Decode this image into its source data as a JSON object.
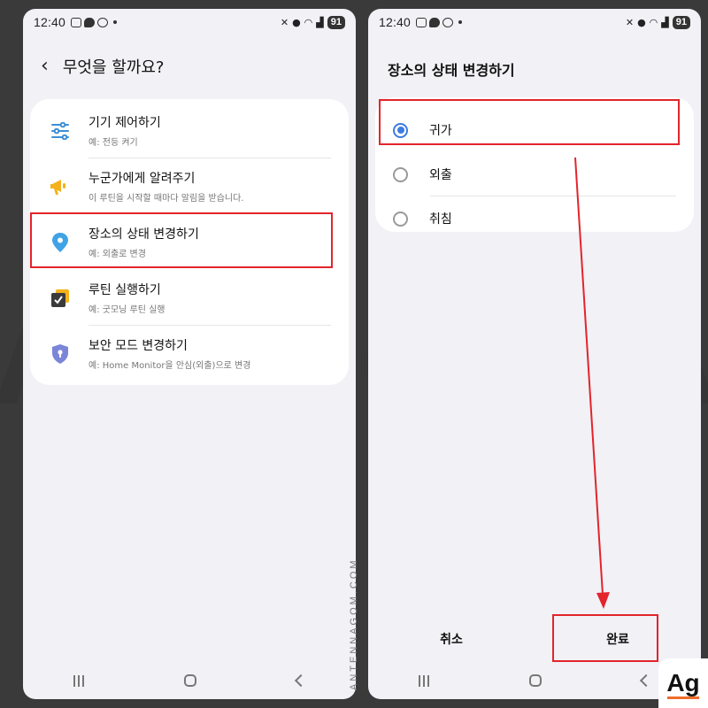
{
  "status": {
    "time": "12:40",
    "battery": "91"
  },
  "left": {
    "title": "무엇을 할까요?",
    "items": [
      {
        "label": "기기 제어하기",
        "desc": "예: 전등 켜기",
        "icon": "sliders-icon"
      },
      {
        "label": "누군가에게 알려주기",
        "desc": "이 루틴을 시작할 때마다 알림을 받습니다.",
        "icon": "megaphone-icon"
      },
      {
        "label": "장소의 상태 변경하기",
        "desc": "예: 외출로 변경",
        "icon": "location-pin-icon"
      },
      {
        "label": "루틴 실행하기",
        "desc": "예: 굿모닝 루틴 실행",
        "icon": "checkbox-icon"
      },
      {
        "label": "보안 모드 변경하기",
        "desc": "예: Home Monitor을 안심(외출)으로 변경",
        "icon": "shield-lock-icon"
      }
    ]
  },
  "right": {
    "title": "장소의 상태 변경하기",
    "options": [
      {
        "label": "귀가",
        "selected": true
      },
      {
        "label": "외출",
        "selected": false
      },
      {
        "label": "취침",
        "selected": false
      }
    ],
    "cancel": "취소",
    "done": "완료"
  },
  "watermark": {
    "text": "Ag",
    "site": "ANTENNAGOM.COM"
  },
  "colors": {
    "highlight": "#e3242b",
    "accent": "#3d7be2",
    "logo_bar": "#ef6c2a"
  }
}
